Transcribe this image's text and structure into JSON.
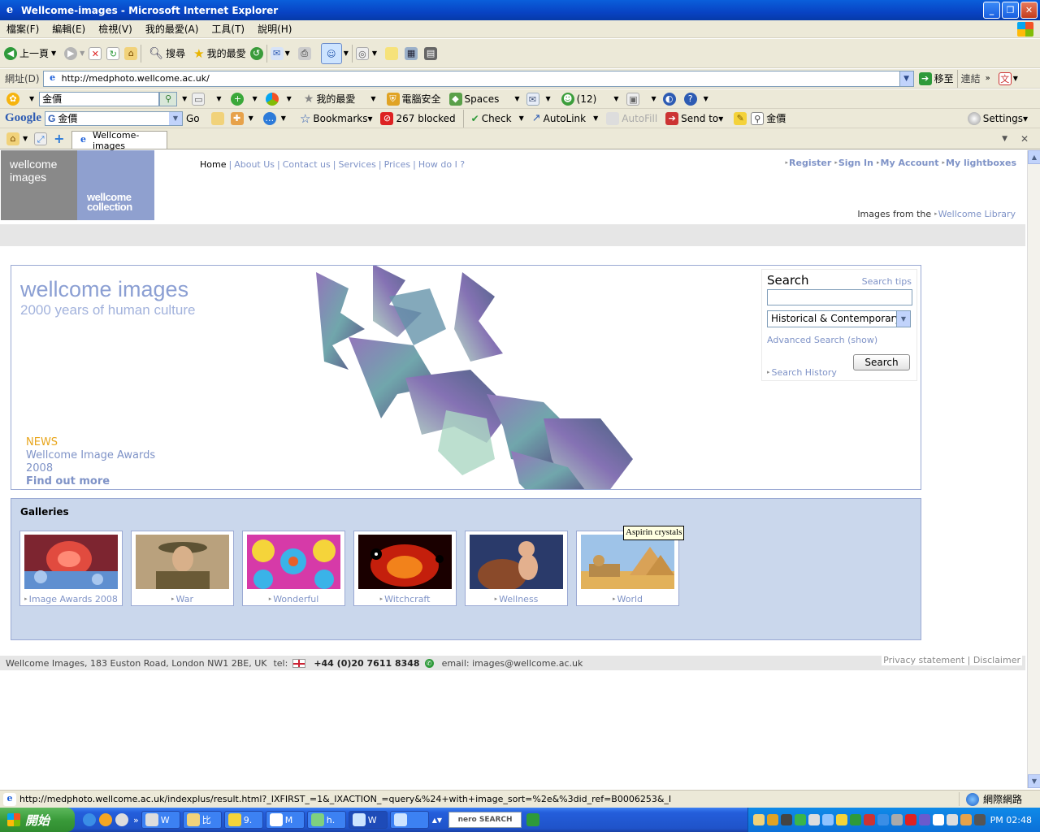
{
  "window": {
    "title": "Wellcome-images - Microsoft Internet Explorer"
  },
  "menu": [
    "檔案(F)",
    "編輯(E)",
    "檢視(V)",
    "我的最愛(A)",
    "工具(T)",
    "說明(H)"
  ],
  "toolbar": {
    "back_label": "上一頁",
    "search_label": "搜尋",
    "favorites_label": "我的最愛"
  },
  "address": {
    "label": "網址(D)",
    "url": "http://medphoto.wellcome.ac.uk/",
    "go_label": "移至",
    "links_label": "連結"
  },
  "toolbar3": {
    "search_value": "金價",
    "favorites_label": "我的最愛",
    "security_label": "電腦安全",
    "spaces_label": "Spaces",
    "contacts_count": "(12)"
  },
  "google_bar": {
    "logo": "Google",
    "search_value": "金價",
    "go_label": "Go",
    "bookmarks_label": "Bookmarks▾",
    "blocked_label": "267 blocked",
    "check_label": "Check",
    "autolink_label": "AutoLink",
    "autofill_label": "AutoFill",
    "sendto_label": "Send to▾",
    "highlight_term": "金價",
    "settings_label": "Settings▾"
  },
  "tab": {
    "label": "Wellcome-images"
  },
  "site": {
    "logo_text_1": "wellcome",
    "logo_text_2": "images",
    "logo2_text_1": "wellcome",
    "logo2_text_2": "collection",
    "nav": [
      "Home",
      "About Us",
      "Contact us",
      "Services",
      "Prices",
      "How do I ?"
    ],
    "user_nav": [
      "Register",
      "Sign In",
      "My Account",
      "My lightboxes"
    ],
    "images_from": "Images from the",
    "images_from_link": "Wellcome Library",
    "hero_title": "wellcome images",
    "hero_subtitle": "2000 years of human culture",
    "news_title": "NEWS",
    "news_text": "Wellcome Image Awards 2008",
    "news_more": "Find out more",
    "search": {
      "heading": "Search",
      "tips": "Search tips",
      "query": "",
      "collection": "Historical & Contemporary",
      "advanced": "Advanced Search (show)",
      "button": "Search",
      "history": "Search History"
    },
    "galleries_heading": "Galleries",
    "galleries": [
      {
        "label": "Image Awards 2008"
      },
      {
        "label": "War"
      },
      {
        "label": "Wonderful"
      },
      {
        "label": "Witchcraft"
      },
      {
        "label": "Wellness"
      },
      {
        "label": "World"
      }
    ],
    "tooltip": "Aspirin crystals",
    "footer": {
      "address": "Wellcome Images, 183 Euston Road, London NW1 2BE, UK",
      "tel_label": "tel:",
      "phone": "+44 (0)20 7611 8348",
      "email": "email: images@wellcome.ac.uk",
      "legal": "Privacy statement | Disclaimer"
    }
  },
  "status": {
    "url": "http://medphoto.wellcome.ac.uk/indexplus/result.html?_IXFIRST_=1&_IXACTION_=query&%24+with+image_sort=%2e&%3did_ref=B0006253&_I",
    "zone": "網際網路"
  },
  "taskbar": {
    "start_label": "開始",
    "apps": [
      "W",
      "比",
      "9.",
      "M",
      "h.",
      "W"
    ],
    "nero_label": "nero SEARCH",
    "clock": "PM 02:48"
  },
  "colors": {
    "accent_link": "#7f93c7",
    "news_orange": "#e8a51b",
    "gallery_bg": "#cad7ec",
    "logo_grey": "#898989",
    "logo_blue": "#8fa0cf"
  }
}
